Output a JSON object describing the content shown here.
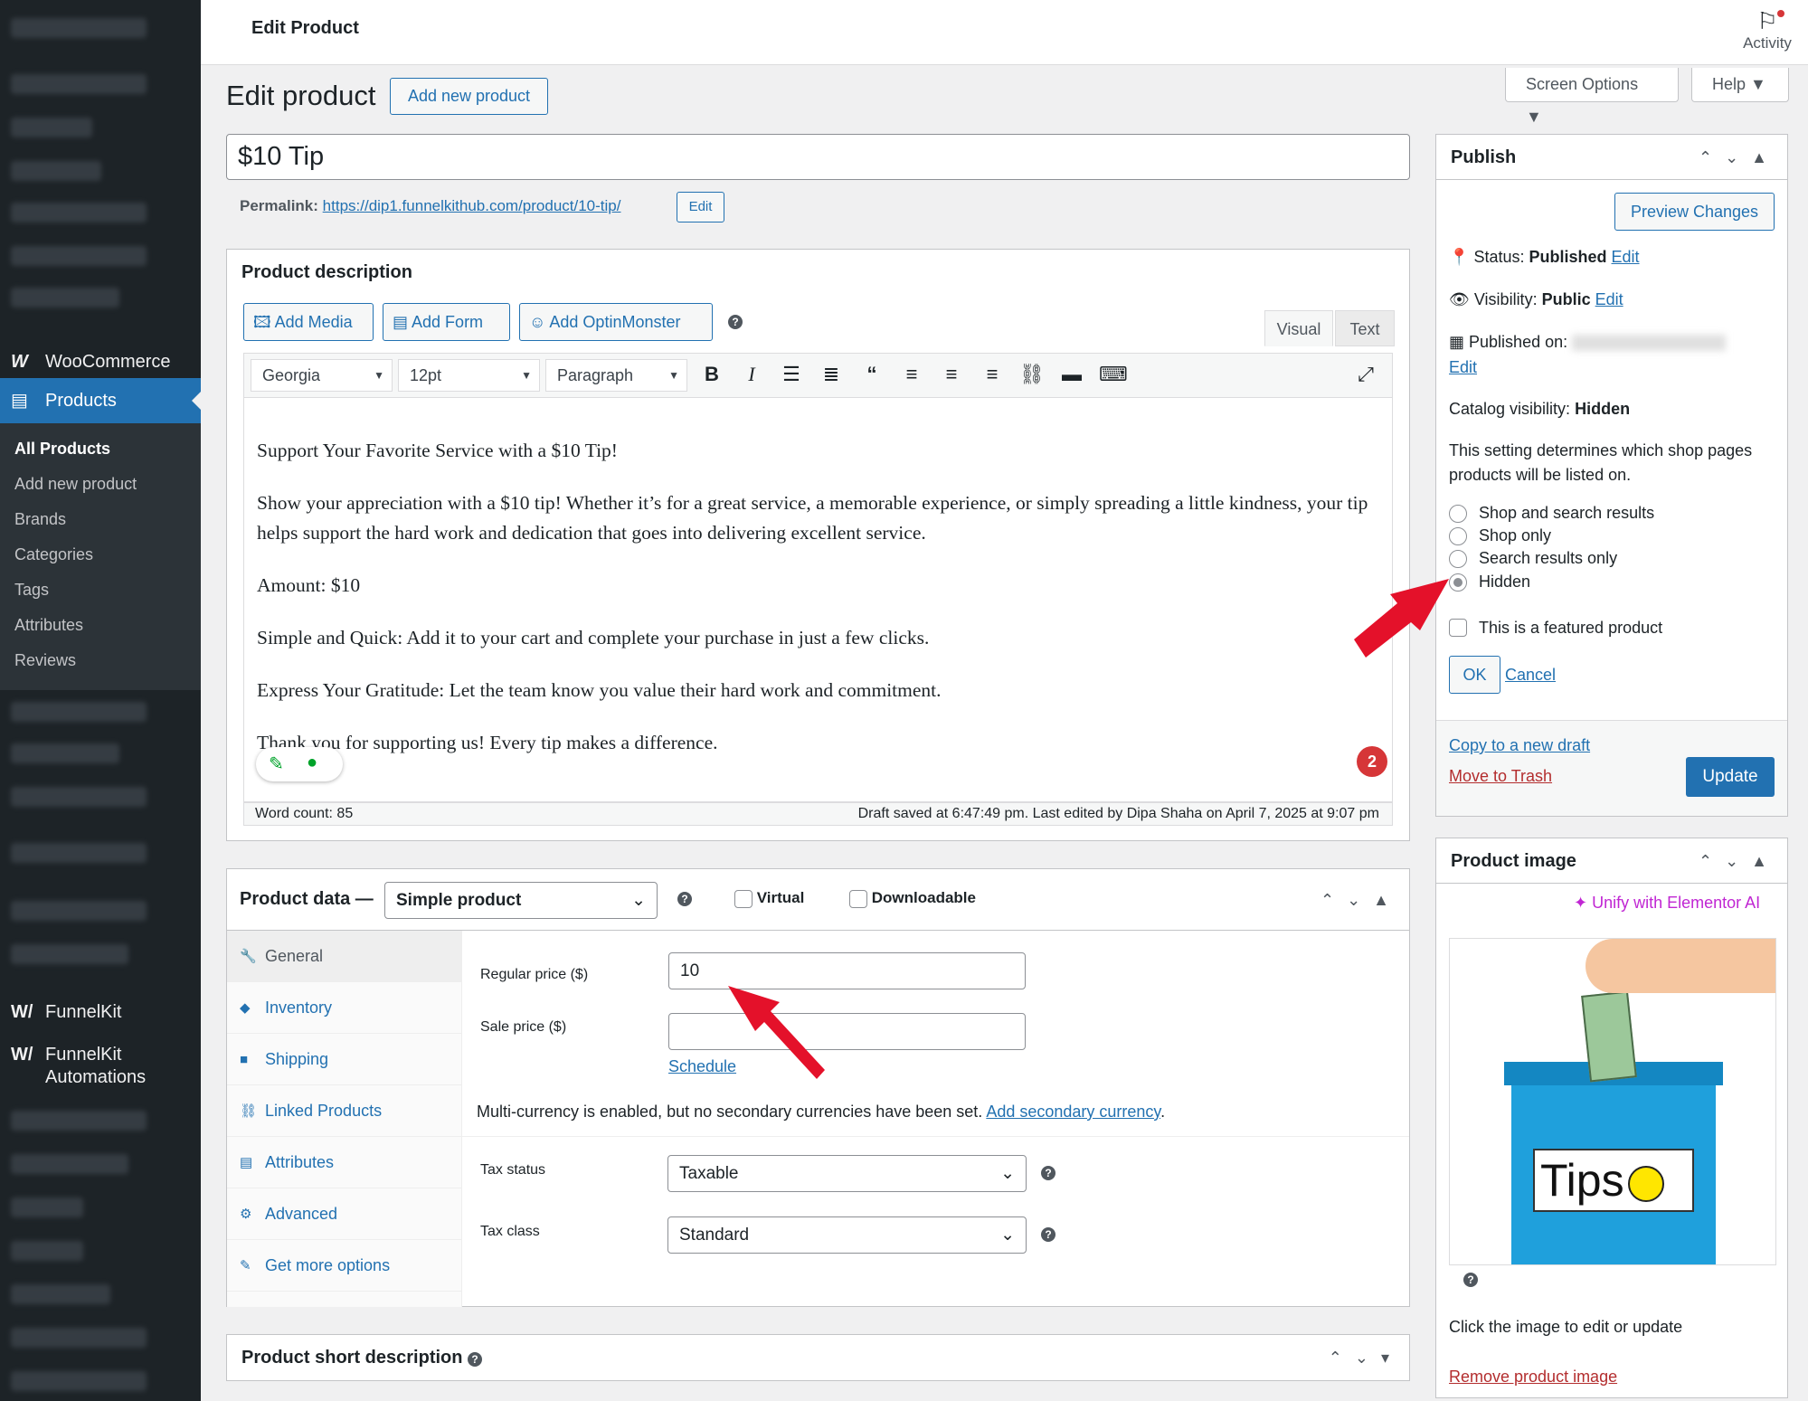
{
  "sidebar": {
    "woocommerce": "WooCommerce",
    "products": "Products",
    "submenu": [
      "All Products",
      "Add new product",
      "Brands",
      "Categories",
      "Tags",
      "Attributes",
      "Reviews"
    ],
    "funnelkit": "FunnelKit",
    "funnelkit_automations_1": "FunnelKit",
    "funnelkit_automations_2": "Automations"
  },
  "topbar": {
    "title": "Edit Product",
    "activity": "Activity",
    "screen_options": "Screen Options ▼",
    "help": "Help ▼"
  },
  "header": {
    "page_title": "Edit product",
    "add_new": "Add new product"
  },
  "product": {
    "title": "$10 Tip",
    "permalink_label": "Permalink:",
    "permalink_url": "https://dip1.funnelkithub.com/product/10-tip/",
    "permalink_edit": "Edit"
  },
  "description": {
    "heading": "Product description",
    "add_media": "Add Media",
    "add_form": "Add Form",
    "add_optinmonster": "Add OptinMonster",
    "tab_visual": "Visual",
    "tab_text": "Text",
    "font": "Georgia",
    "size": "12pt",
    "format": "Paragraph",
    "paragraphs": [
      "Support Your Favorite Service with a $10 Tip!",
      "Show your appreciation with a $10 tip! Whether it’s for a great service, a memorable experience, or simply spreading a little kindness, your tip helps support the hard work and dedication that goes into delivering excellent service.",
      "Amount: $10",
      "Simple and Quick: Add it to your cart and complete your purchase in just a few clicks.",
      "Express Your Gratitude: Let the team know you value their hard work and commitment.",
      "Thank you for supporting us! Every tip makes a difference."
    ],
    "word_count": "Word count: 85",
    "draft_saved": "Draft saved at 6:47:49 pm. Last edited by Dipa Shaha on April 7, 2025 at 9:07 pm",
    "badge": "2"
  },
  "product_data": {
    "label": "Product data —",
    "type": "Simple product",
    "virtual": "Virtual",
    "downloadable": "Downloadable",
    "tabs": [
      "General",
      "Inventory",
      "Shipping",
      "Linked Products",
      "Attributes",
      "Advanced",
      "Get more options"
    ],
    "regular_price_label": "Regular price ($)",
    "regular_price": "10",
    "sale_price_label": "Sale price ($)",
    "sale_price": "",
    "schedule": "Schedule",
    "multicurrency": "Multi-currency is enabled, but no secondary currencies have been set.",
    "add_secondary": "Add secondary currency",
    "tax_status_label": "Tax status",
    "tax_status": "Taxable",
    "tax_class_label": "Tax class",
    "tax_class": "Standard"
  },
  "short_description": {
    "heading": "Product short description"
  },
  "publish": {
    "heading": "Publish",
    "preview": "Preview Changes",
    "status_label": "Status:",
    "status": "Published",
    "visibility_label": "Visibility:",
    "visibility": "Public",
    "published_on": "Published on:",
    "edit": "Edit",
    "catalog_label": "Catalog visibility:",
    "catalog": "Hidden",
    "catalog_desc": "This setting determines which shop pages products will be listed on.",
    "options": [
      "Shop and search results",
      "Shop only",
      "Search results only",
      "Hidden"
    ],
    "featured": "This is a featured product",
    "ok": "OK",
    "cancel": "Cancel",
    "copy_draft": "Copy to a new draft",
    "trash": "Move to Trash",
    "update": "Update"
  },
  "product_image": {
    "heading": "Product image",
    "unify": "Unify with Elementor AI",
    "image_text": "Tips",
    "click_hint": "Click the image to edit or update",
    "remove": "Remove product image"
  },
  "colors": {
    "primary": "#2271b1",
    "sidebar": "#1d2327",
    "danger": "#d63638",
    "arrow": "#e4112a"
  }
}
